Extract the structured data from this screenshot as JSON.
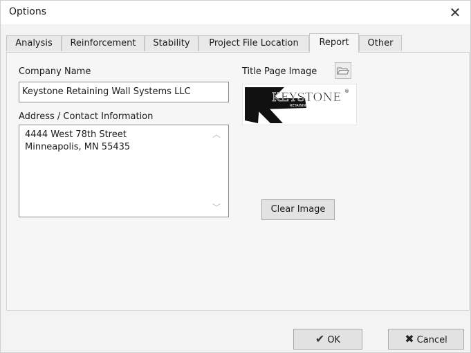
{
  "window": {
    "title": "Options",
    "close_glyph": "✕"
  },
  "tabs": [
    {
      "label": "Analysis",
      "active": false
    },
    {
      "label": "Reinforcement",
      "active": false
    },
    {
      "label": "Stability",
      "active": false
    },
    {
      "label": "Project File Location",
      "active": false
    },
    {
      "label": "Report",
      "active": true
    },
    {
      "label": "Other",
      "active": false
    }
  ],
  "report": {
    "company_name_label": "Company Name",
    "company_name_value": "Keystone Retaining Wall Systems LLC",
    "address_label": "Address / Contact Information",
    "address_lines": [
      "4444 West 78th Street",
      "Minneapolis, MN 55435"
    ],
    "title_page_image_label": "Title Page Image",
    "logo": {
      "brand_text": "KEYSTONE",
      "sub_text": "RETAINING WALL SYSTEMS",
      "mark": "®"
    },
    "clear_image_label": "Clear Image"
  },
  "footer": {
    "ok_label": "OK",
    "cancel_label": "Cancel"
  },
  "colors": {
    "ok_check": "#333333",
    "cancel_x": "#222222",
    "logo_black": "#111111"
  }
}
